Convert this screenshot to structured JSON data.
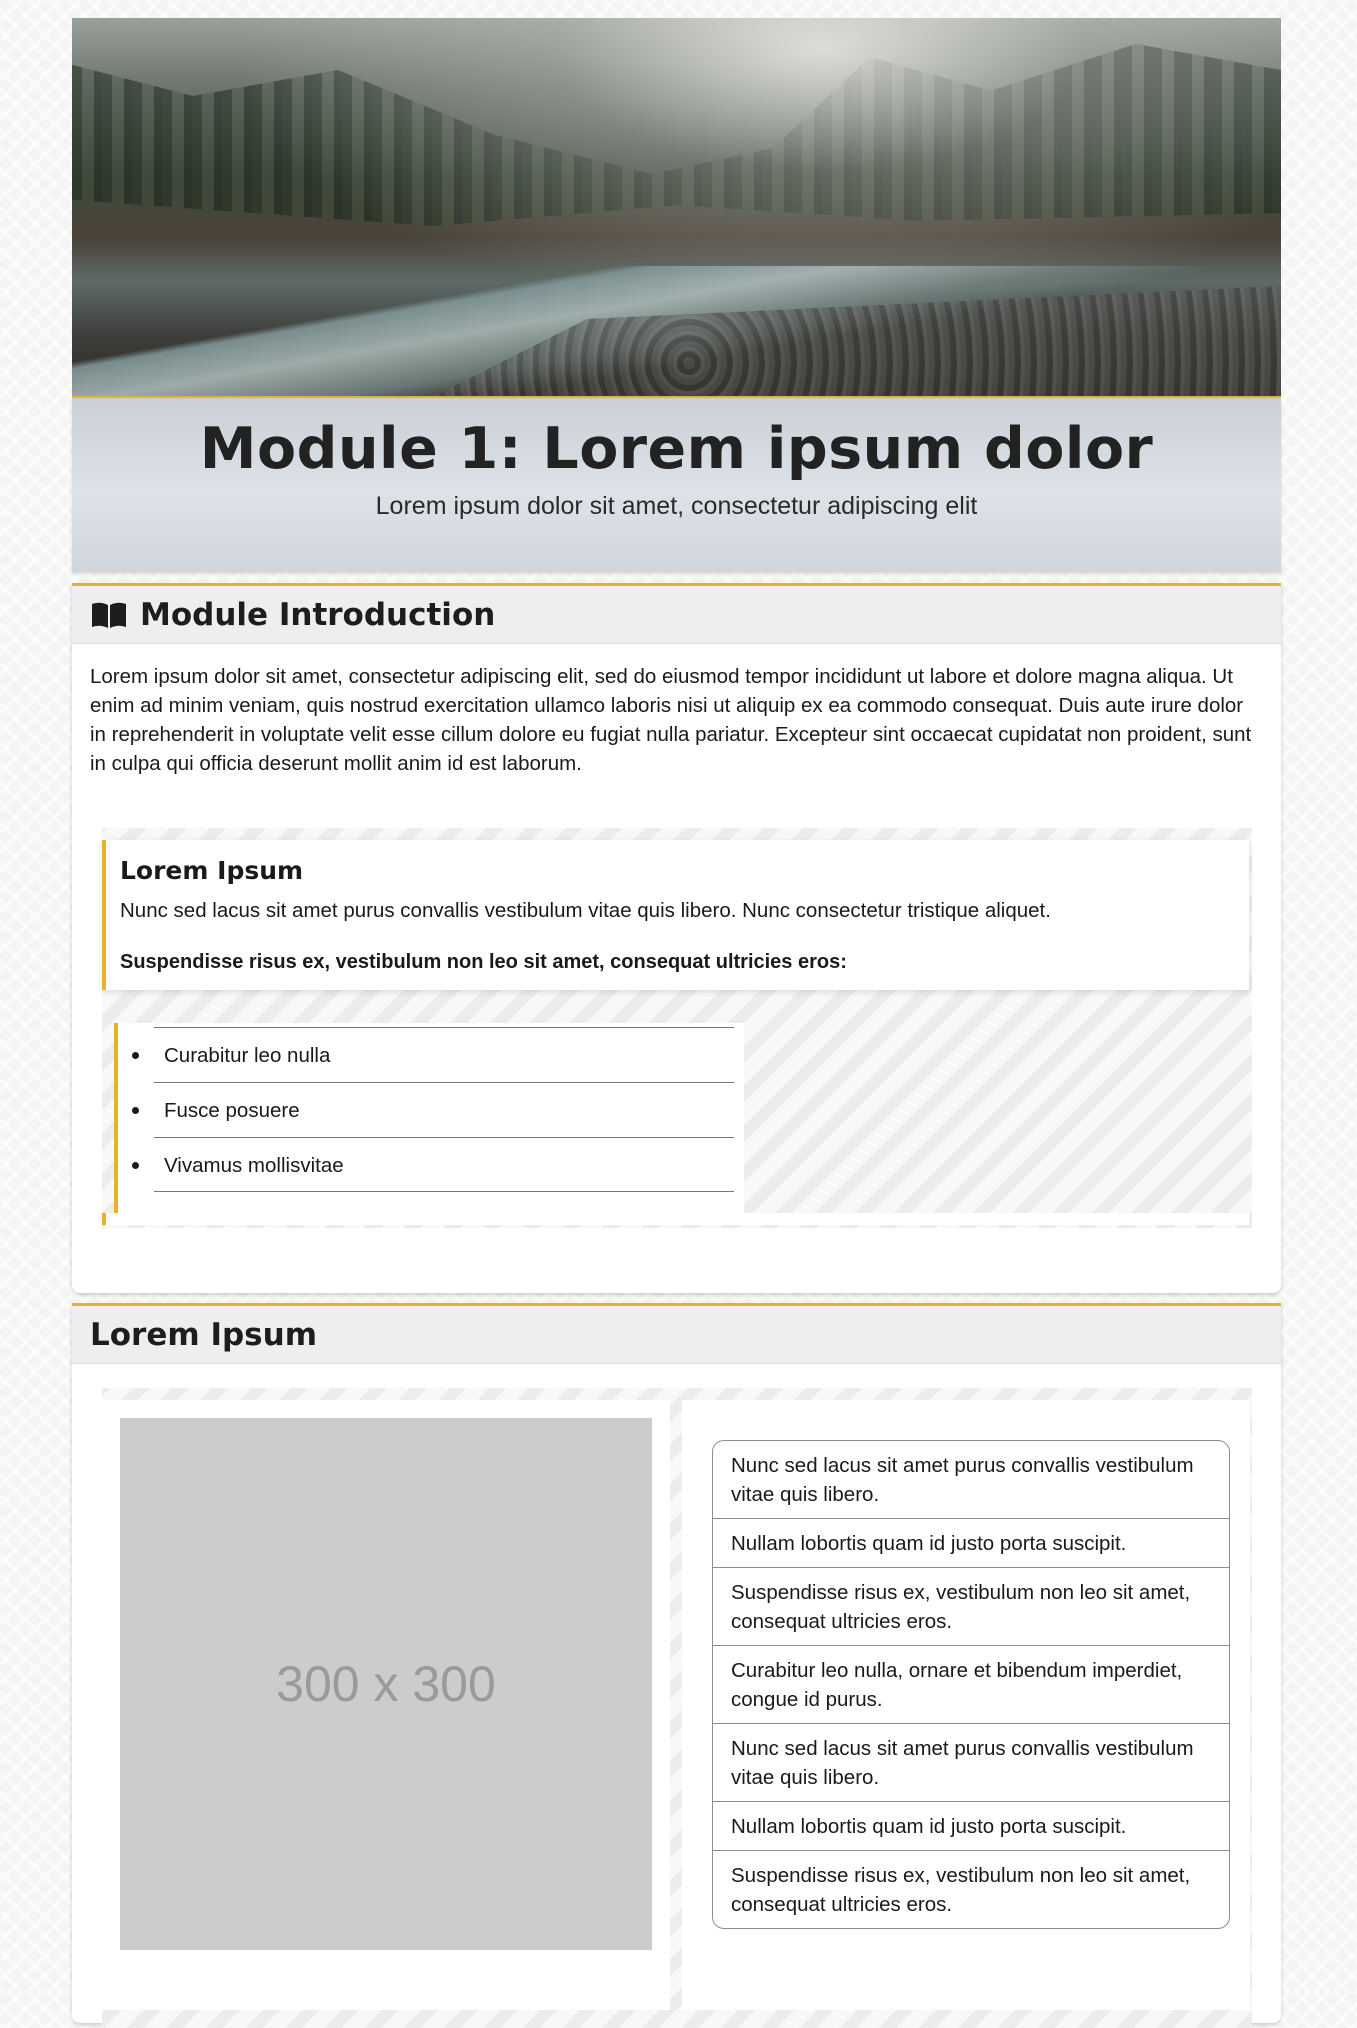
{
  "header": {
    "title": "Module 1: Lorem ipsum dolor",
    "subtitle": "Lorem ipsum dolor sit amet, consectetur adipiscing elit"
  },
  "intro": {
    "heading": "Module Introduction",
    "icon": "book-icon",
    "body": "Lorem ipsum dolor sit amet, consectetur adipiscing elit, sed do eiusmod tempor incididunt ut labore et dolore magna aliqua. Ut enim ad minim veniam, quis nostrud exercitation ullamco laboris nisi ut aliquip ex ea commodo consequat. Duis aute irure dolor in reprehenderit in voluptate velit esse cillum dolore eu fugiat nulla pariatur. Excepteur sint occaecat cupidatat non proident, sunt in culpa qui officia deserunt mollit anim id est laborum.",
    "callout": {
      "title": "Lorem Ipsum",
      "text": "Nunc sed lacus sit amet purus convallis vestibulum vitae quis libero. Nunc consectetur tristique aliquet.",
      "lead": "Suspendisse risus ex, vestibulum non leo sit amet, consequat ultricies eros:",
      "items": [
        "Curabitur leo nulla",
        "Fusce posuere",
        "Vivamus mollisvitae"
      ]
    }
  },
  "section2": {
    "heading": "Lorem Ipsum",
    "placeholder_label": "300 x 300",
    "items": [
      "Nunc sed lacus sit amet purus convallis vestibulum vitae quis libero.",
      "Nullam lobortis quam id justo porta suscipit.",
      "Suspendisse risus ex, vestibulum non leo sit amet, consequat ultricies eros.",
      "Curabitur leo nulla, ornare et bibendum imperdiet, congue id purus.",
      "Nunc sed lacus sit amet purus convallis vestibulum vitae quis libero.",
      "Nullam lobortis quam id justo porta suscipit.",
      "Suspendisse risus ex, vestibulum non leo sit amet, consequat ultricies eros."
    ]
  },
  "colors": {
    "accent": "#e7b12a",
    "header_band": "#dde2e7",
    "card_header": "#eceef0",
    "placeholder": "#cccccc"
  }
}
